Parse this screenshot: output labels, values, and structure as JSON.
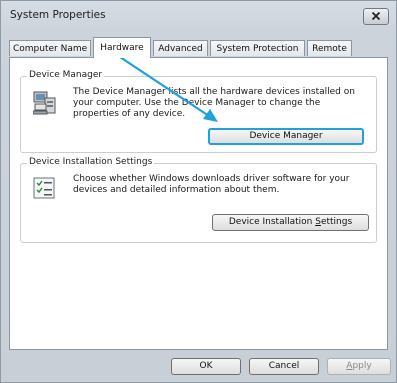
{
  "window": {
    "title": "System Properties"
  },
  "tabs": [
    {
      "label": "Computer Name"
    },
    {
      "label": "Hardware"
    },
    {
      "label": "Advanced"
    },
    {
      "label": "System Protection"
    },
    {
      "label": "Remote"
    }
  ],
  "device_manager": {
    "legend": "Device Manager",
    "line1": "The Device Manager lists all the hardware devices installed on",
    "line2": "your computer. Use the Device Manager to change the",
    "line3": "properties of any device.",
    "button": "Device Manager"
  },
  "install_settings": {
    "legend": "Device Installation Settings",
    "line1": "Choose whether Windows downloads driver software for your",
    "line2": "devices and detailed information about them.",
    "button_pre": "Device Installation ",
    "button_accel": "S",
    "button_post": "ettings"
  },
  "footer": {
    "ok": "OK",
    "cancel": "Cancel",
    "apply_accel": "A",
    "apply_rest": "pply"
  },
  "colors": {
    "highlight": "#1fa0df"
  }
}
